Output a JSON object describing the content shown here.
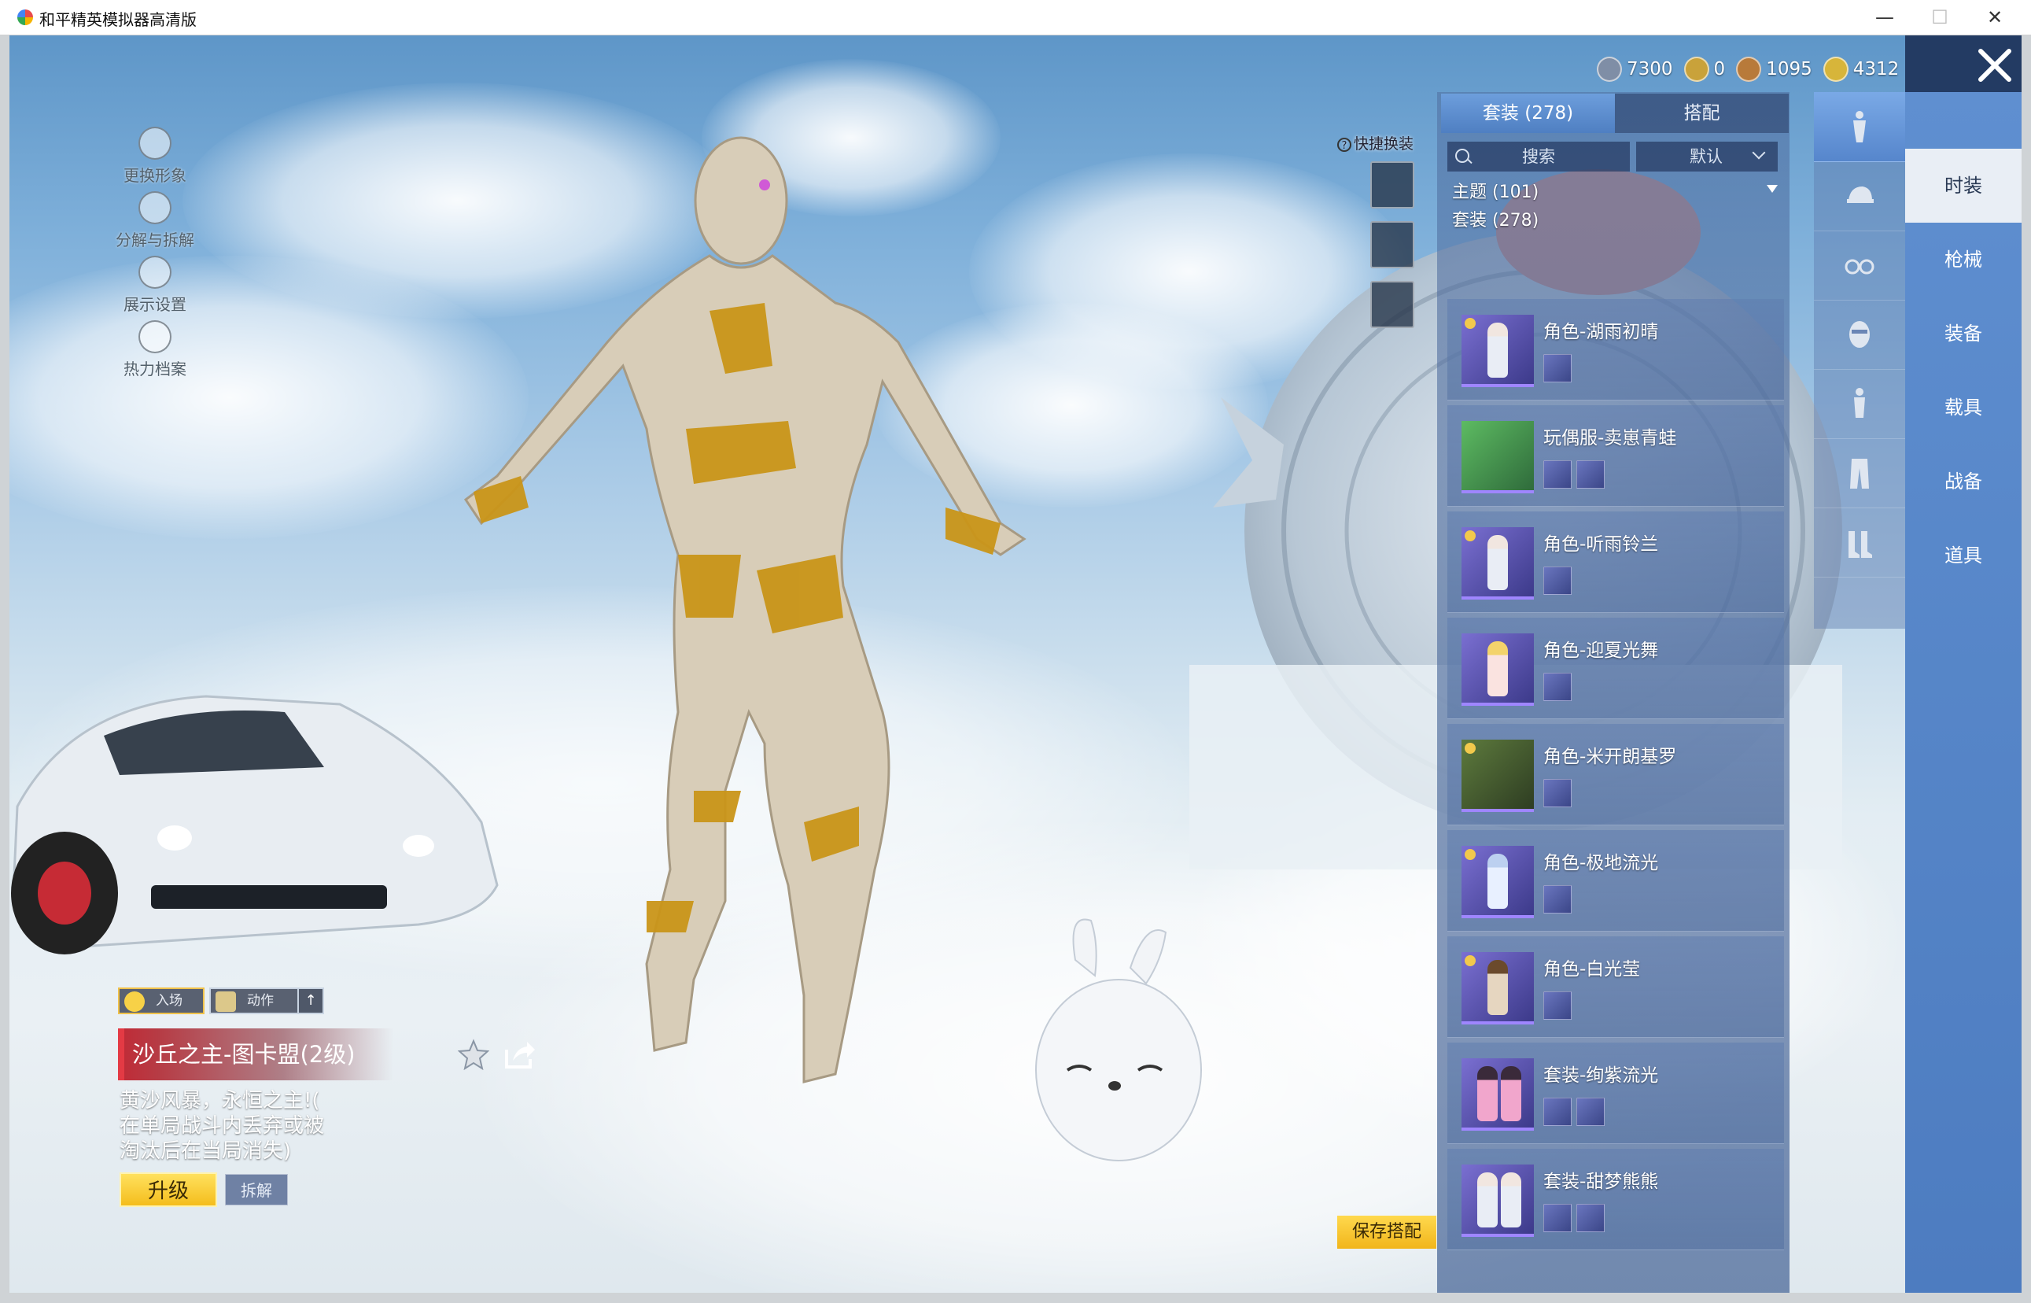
{
  "window": {
    "title": "和平精英模拟器高清版",
    "minimize": "—",
    "maximize": "☐",
    "close": "✕"
  },
  "left_menu": [
    {
      "label": "更换形象",
      "icon": "avatar-icon"
    },
    {
      "label": "分解与拆解",
      "icon": "dismantle-icon"
    },
    {
      "label": "展示设置",
      "icon": "eye-icon"
    },
    {
      "label": "热力档案",
      "icon": "fire-icon"
    }
  ],
  "quick_change": {
    "label": "快捷换装",
    "help": "?"
  },
  "currency": [
    {
      "value": "7300",
      "icon": "coin-silver-icon",
      "color": "#7f8ea6"
    },
    {
      "value": "0",
      "icon": "coin-gold-a-icon",
      "color": "#c9a23a"
    },
    {
      "value": "1095",
      "icon": "coin-bronze-icon",
      "color": "#b87a3a"
    },
    {
      "value": "4312",
      "icon": "lightning-coin-icon",
      "color": "#d7b53a"
    }
  ],
  "panel": {
    "tabs": [
      {
        "label": "套装 (278)"
      },
      {
        "label": "搭配"
      }
    ],
    "search_placeholder": "搜索",
    "sort_label": "默认",
    "filter_theme": "主题 (101)",
    "filter_suit": "套装 (278)",
    "items": [
      {
        "name": "角色-湖雨初晴",
        "subs": 1
      },
      {
        "name": "玩偶服-卖崽青蛙",
        "subs": 2
      },
      {
        "name": "角色-听雨铃兰",
        "subs": 1
      },
      {
        "name": "角色-迎夏光舞",
        "subs": 1
      },
      {
        "name": "角色-米开朗基罗",
        "subs": 1
      },
      {
        "name": "角色-极地流光",
        "subs": 1
      },
      {
        "name": "角色-白光莹",
        "subs": 1
      },
      {
        "name": "套装-绚紫流光",
        "subs": 2
      },
      {
        "name": "套装-甜梦熊熊",
        "subs": 2
      }
    ]
  },
  "right_tabs": [
    "时装",
    "枪械",
    "装备",
    "载具",
    "战备",
    "道具"
  ],
  "bottom_left": {
    "entrance_label": "入场",
    "action_label": "动作",
    "up_label": "↑",
    "item_title": "沙丘之主-图卡盟(2级)",
    "description_lines": [
      "黄沙风暴，永恒之主!(",
      "在单局战斗内丢弃或被",
      "淘汰后在当局消失)"
    ],
    "upgrade_label": "升级",
    "dismantle_label": "拆解"
  },
  "save_label": "保存搭配"
}
